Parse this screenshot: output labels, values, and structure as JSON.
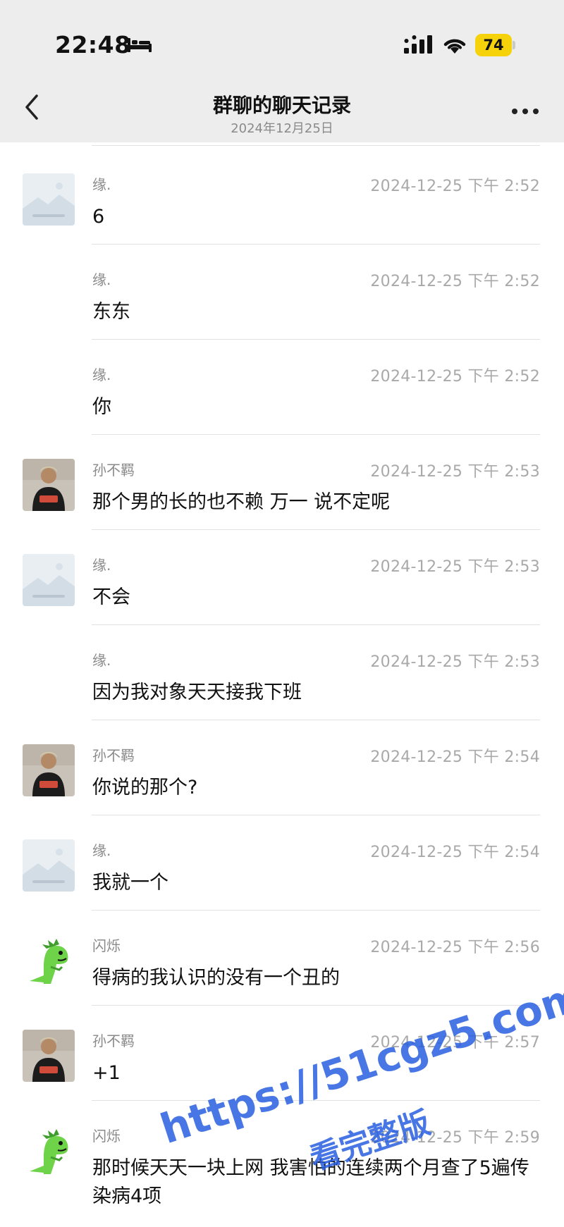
{
  "status_bar": {
    "time": "22:48",
    "battery": "74",
    "battery_color": "#f6d20b"
  },
  "nav": {
    "title": "群聊的聊天记录",
    "subtitle": "2024年12月25日"
  },
  "messages": [
    {
      "sender": "缘.",
      "time": "2024-12-25 下午 2:52",
      "text": "6",
      "avatar": "landscape-placeholder"
    },
    {
      "sender": "缘.",
      "time": "2024-12-25 下午 2:52",
      "text": "东东",
      "avatar": ""
    },
    {
      "sender": "缘.",
      "time": "2024-12-25 下午 2:52",
      "text": "你",
      "avatar": ""
    },
    {
      "sender": "孙不羁",
      "time": "2024-12-25 下午 2:53",
      "text": "那个男的长的也不赖 万一 说不定呢",
      "avatar": "person-photo"
    },
    {
      "sender": "缘.",
      "time": "2024-12-25 下午 2:53",
      "text": "不会",
      "avatar": "landscape-placeholder"
    },
    {
      "sender": "缘.",
      "time": "2024-12-25 下午 2:53",
      "text": "因为我对象天天接我下班",
      "avatar": ""
    },
    {
      "sender": "孙不羁",
      "time": "2024-12-25 下午 2:54",
      "text": "你说的那个?",
      "avatar": "person-photo"
    },
    {
      "sender": "缘.",
      "time": "2024-12-25 下午 2:54",
      "text": "我就一个",
      "avatar": "landscape-placeholder"
    },
    {
      "sender": "闪烁",
      "time": "2024-12-25 下午 2:56",
      "text": "得病的我认识的没有一个丑的",
      "avatar": "dinosaur"
    },
    {
      "sender": "孙不羁",
      "time": "2024-12-25 下午 2:57",
      "text": "+1",
      "avatar": "person-photo"
    },
    {
      "sender": "闪烁",
      "time": "2024-12-25 下午 2:59",
      "text": "那时候天天一块上网 我害怕的连续两个月查了5遍传染病4项",
      "avatar": "dinosaur"
    }
  ],
  "watermark": {
    "line1": "https://51cgz5.com",
    "line2": "看完整版",
    "color": "#285fe1"
  }
}
